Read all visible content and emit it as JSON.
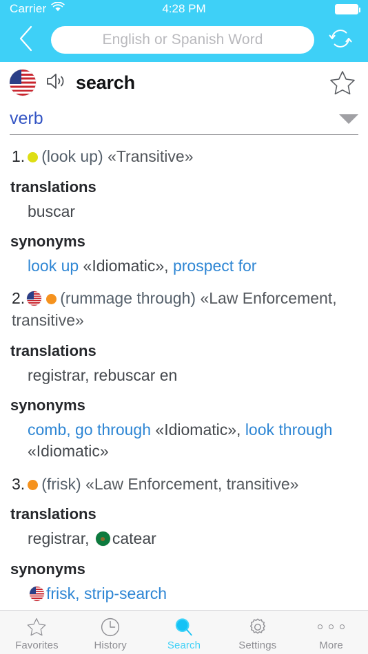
{
  "status_bar": {
    "carrier": "Carrier",
    "wifi_icon": "wifi-icon",
    "time": "4:28 PM",
    "battery_icon": "battery-full-icon"
  },
  "navbar": {
    "back_icon": "chevron-left-icon",
    "swap_icon": "swap-languages-icon",
    "search_placeholder": "English or Spanish Word",
    "search_value": ""
  },
  "word_header": {
    "language_flag": "us-flag-icon",
    "audio_icon": "speaker-icon",
    "word": "search",
    "favorite_icon": "star-outline-icon"
  },
  "pos_selector": {
    "label": "verb",
    "caret_icon": "chevron-down-icon"
  },
  "labels": {
    "translations": "translations",
    "synonyms": "synonyms"
  },
  "senses": [
    {
      "number": "1.",
      "dot_color": "#dede14",
      "flag": null,
      "gloss": "(look up)",
      "register": "«Transitive»",
      "translations": "buscar",
      "translations_flag": null,
      "synonyms_prefix_flag": null,
      "synonyms_parts": [
        {
          "text": "look up",
          "style": "link"
        },
        {
          "text": " «Idiomatic», ",
          "style": "plain"
        },
        {
          "text": "prospect for",
          "style": "link"
        }
      ]
    },
    {
      "number": "2.",
      "dot_color": "#f5921e",
      "flag": "us-flag-icon",
      "gloss": "(rummage through)",
      "register": "«Law Enforcement, transitive»",
      "translations": "registrar, rebuscar en",
      "translations_flag": null,
      "synonyms_prefix_flag": null,
      "synonyms_parts": [
        {
          "text": "comb, go through",
          "style": "link"
        },
        {
          "text": " «Idiomatic», ",
          "style": "plain"
        },
        {
          "text": "look through",
          "style": "link"
        },
        {
          "text": " «Idiomatic»",
          "style": "plain"
        }
      ]
    },
    {
      "number": "3.",
      "dot_color": "#f5921e",
      "flag": null,
      "gloss": "(frisk)",
      "register": "«Law Enforcement, transitive»",
      "translations": "registrar, ",
      "translations_flag": "mx-flag-icon",
      "translations_suffix": "catear",
      "synonyms_prefix_flag": "us-flag-icon",
      "synonyms_parts": [
        {
          "text": "frisk, strip-search",
          "style": "link"
        }
      ]
    }
  ],
  "tabbar": {
    "items": [
      {
        "label": "Favorites",
        "icon": "star-outline-icon",
        "active": false
      },
      {
        "label": "History",
        "icon": "clock-icon",
        "active": false
      },
      {
        "label": "Search",
        "icon": "magnifier-icon",
        "active": true
      },
      {
        "label": "Settings",
        "icon": "gear-icon",
        "active": false
      },
      {
        "label": "More",
        "icon": "ellipsis-icon",
        "active": false
      }
    ]
  },
  "colors": {
    "accent": "#3ed0f7",
    "link": "#2e86d4",
    "pos": "#3455c4",
    "dot_yellow": "#dede14",
    "dot_orange": "#f5921e"
  }
}
